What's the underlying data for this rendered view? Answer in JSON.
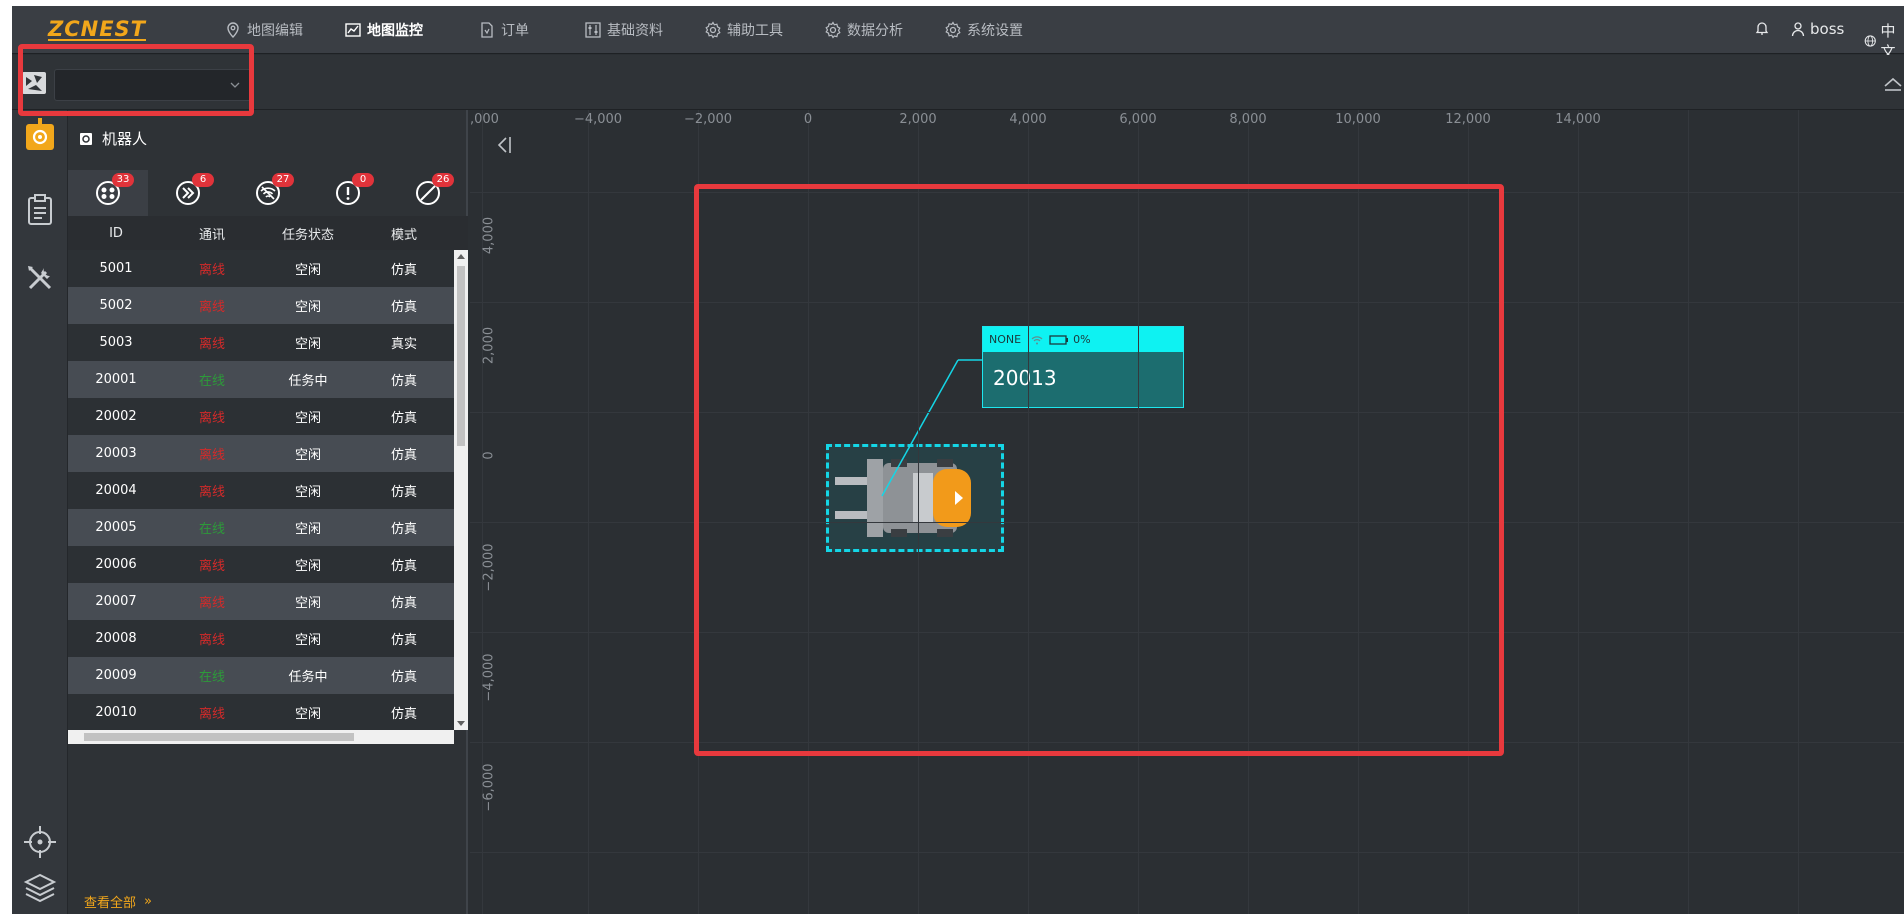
{
  "app": {
    "logo": "ZCNEST",
    "nav": [
      {
        "label": "地图编辑",
        "icon": "location-pin-icon"
      },
      {
        "label": "地图监控",
        "icon": "chart-line-icon",
        "active": true
      },
      {
        "label": "订单",
        "icon": "document-icon"
      },
      {
        "label": "基础资料",
        "icon": "sliders-icon"
      },
      {
        "label": "辅助工具",
        "icon": "gear-icon"
      },
      {
        "label": "数据分析",
        "icon": "gear-icon"
      },
      {
        "label": "系统设置",
        "icon": "gear-icon"
      }
    ],
    "user": "boss",
    "language": "中文"
  },
  "toolbar": {
    "map_select_value": ""
  },
  "panel": {
    "title": "机器人",
    "tabs": [
      {
        "icon": "all-robots-icon",
        "count": "33"
      },
      {
        "icon": "running-icon",
        "count": "6"
      },
      {
        "icon": "offline-signal-icon",
        "count": "27"
      },
      {
        "icon": "alert-icon",
        "count": "0"
      },
      {
        "icon": "disabled-icon",
        "count": "26"
      }
    ],
    "columns": [
      "ID",
      "通讯",
      "任务状态",
      "模式"
    ],
    "rows": [
      {
        "id": "5001",
        "comm": "离线",
        "comm_status": "off",
        "task": "空闲",
        "mode": "仿真"
      },
      {
        "id": "5002",
        "comm": "离线",
        "comm_status": "off",
        "task": "空闲",
        "mode": "仿真"
      },
      {
        "id": "5003",
        "comm": "离线",
        "comm_status": "off",
        "task": "空闲",
        "mode": "真实"
      },
      {
        "id": "20001",
        "comm": "在线",
        "comm_status": "on",
        "task": "任务中",
        "mode": "仿真"
      },
      {
        "id": "20002",
        "comm": "离线",
        "comm_status": "off",
        "task": "空闲",
        "mode": "仿真"
      },
      {
        "id": "20003",
        "comm": "离线",
        "comm_status": "off",
        "task": "空闲",
        "mode": "仿真"
      },
      {
        "id": "20004",
        "comm": "离线",
        "comm_status": "off",
        "task": "空闲",
        "mode": "仿真"
      },
      {
        "id": "20005",
        "comm": "在线",
        "comm_status": "on",
        "task": "空闲",
        "mode": "仿真"
      },
      {
        "id": "20006",
        "comm": "离线",
        "comm_status": "off",
        "task": "空闲",
        "mode": "仿真"
      },
      {
        "id": "20007",
        "comm": "离线",
        "comm_status": "off",
        "task": "空闲",
        "mode": "仿真"
      },
      {
        "id": "20008",
        "comm": "离线",
        "comm_status": "off",
        "task": "空闲",
        "mode": "仿真"
      },
      {
        "id": "20009",
        "comm": "在线",
        "comm_status": "on",
        "task": "任务中",
        "mode": "仿真"
      },
      {
        "id": "20010",
        "comm": "离线",
        "comm_status": "off",
        "task": "空闲",
        "mode": "仿真"
      }
    ],
    "view_all": "查看全部",
    "view_all_arrow": "»"
  },
  "map": {
    "x_ticks": [
      ",000",
      "−4,000",
      "−2,000",
      "0",
      "2,000",
      "4,000",
      "6,000",
      "8,000",
      "10,000",
      "12,000",
      "14,000"
    ],
    "y_ticks": [
      "4,000",
      "2,000",
      "0",
      "−2,000",
      "−4,000",
      "−6,000"
    ],
    "tooltip": {
      "status": "NONE",
      "battery": "0%",
      "robot_id": "20013"
    }
  },
  "colors": {
    "accent": "#f2a71b",
    "offline": "#d42a2a",
    "online": "#2d9a3a",
    "highlight": "#14d6e6",
    "annotation": "#e8393d"
  }
}
